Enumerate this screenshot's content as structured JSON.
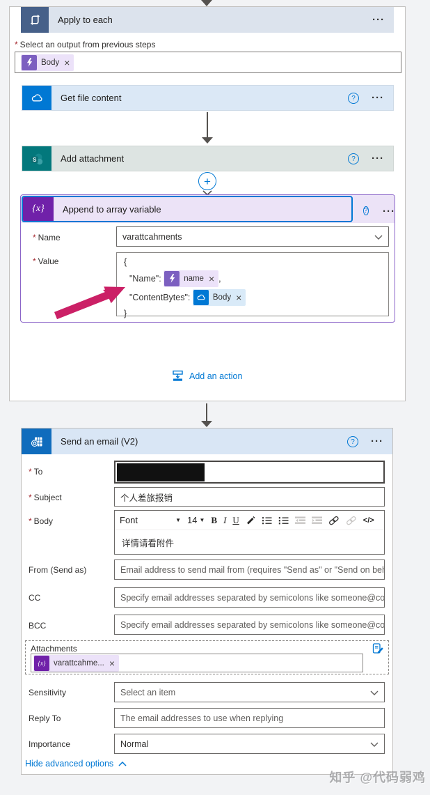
{
  "colors": {
    "accent_blue": "#0078d4",
    "apply_icon": "#466089",
    "onedrive_icon": "#0078d4",
    "sharepoint_icon": "#03787c",
    "variable_icon": "#7021a9",
    "outlook_icon": "#0f6cbd",
    "selection_border": "#0078d4",
    "append_border": "#8b64c8",
    "annotation_arrow": "#cb2066",
    "required": "#a4262c"
  },
  "ui": {
    "required_mark": "*",
    "menu_dots": "···",
    "help": "?",
    "close": "×",
    "plus": "+"
  },
  "apply_to_each": {
    "title": "Apply to each",
    "select_output_label": "Select an output from previous steps",
    "output_token": "Body"
  },
  "get_file": {
    "title": "Get file content"
  },
  "add_attachment": {
    "title": "Add attachment"
  },
  "append": {
    "title": "Append to array variable",
    "name_label": "Name",
    "name_value": "varattcahments",
    "value_label": "Value",
    "json_open": "{",
    "name_key": "\"Name\":",
    "name_token": "name",
    "comma": ",",
    "content_key": "\"ContentBytes\":",
    "body_token": "Body",
    "json_close": "}"
  },
  "add_action": {
    "label": "Add an action"
  },
  "send_email": {
    "title": "Send an email (V2)",
    "to_label": "To",
    "subject_label": "Subject",
    "subject_value": "个人差旅报销",
    "body_label": "Body",
    "body_text": "详情请看附件",
    "toolbar": {
      "font": "Font",
      "size": "14",
      "bold": "B",
      "italic": "I",
      "underline": "U",
      "code": "</>"
    },
    "from_label": "From (Send as)",
    "from_placeholder": "Email address to send mail from (requires \"Send as\" or \"Send on beh",
    "cc_label": "CC",
    "cc_placeholder": "Specify email addresses separated by semicolons like someone@con",
    "bcc_label": "BCC",
    "bcc_placeholder": "Specify email addresses separated by semicolons like someone@con",
    "attachments_label": "Attachments",
    "attachments_token": "varattcahme...",
    "sensitivity_label": "Sensitivity",
    "sensitivity_value": "Select an item",
    "replyto_label": "Reply To",
    "replyto_placeholder": "The email addresses to use when replying",
    "importance_label": "Importance",
    "importance_value": "Normal",
    "hide_advanced": "Hide advanced options"
  },
  "watermark": "知乎 @代码弱鸡"
}
